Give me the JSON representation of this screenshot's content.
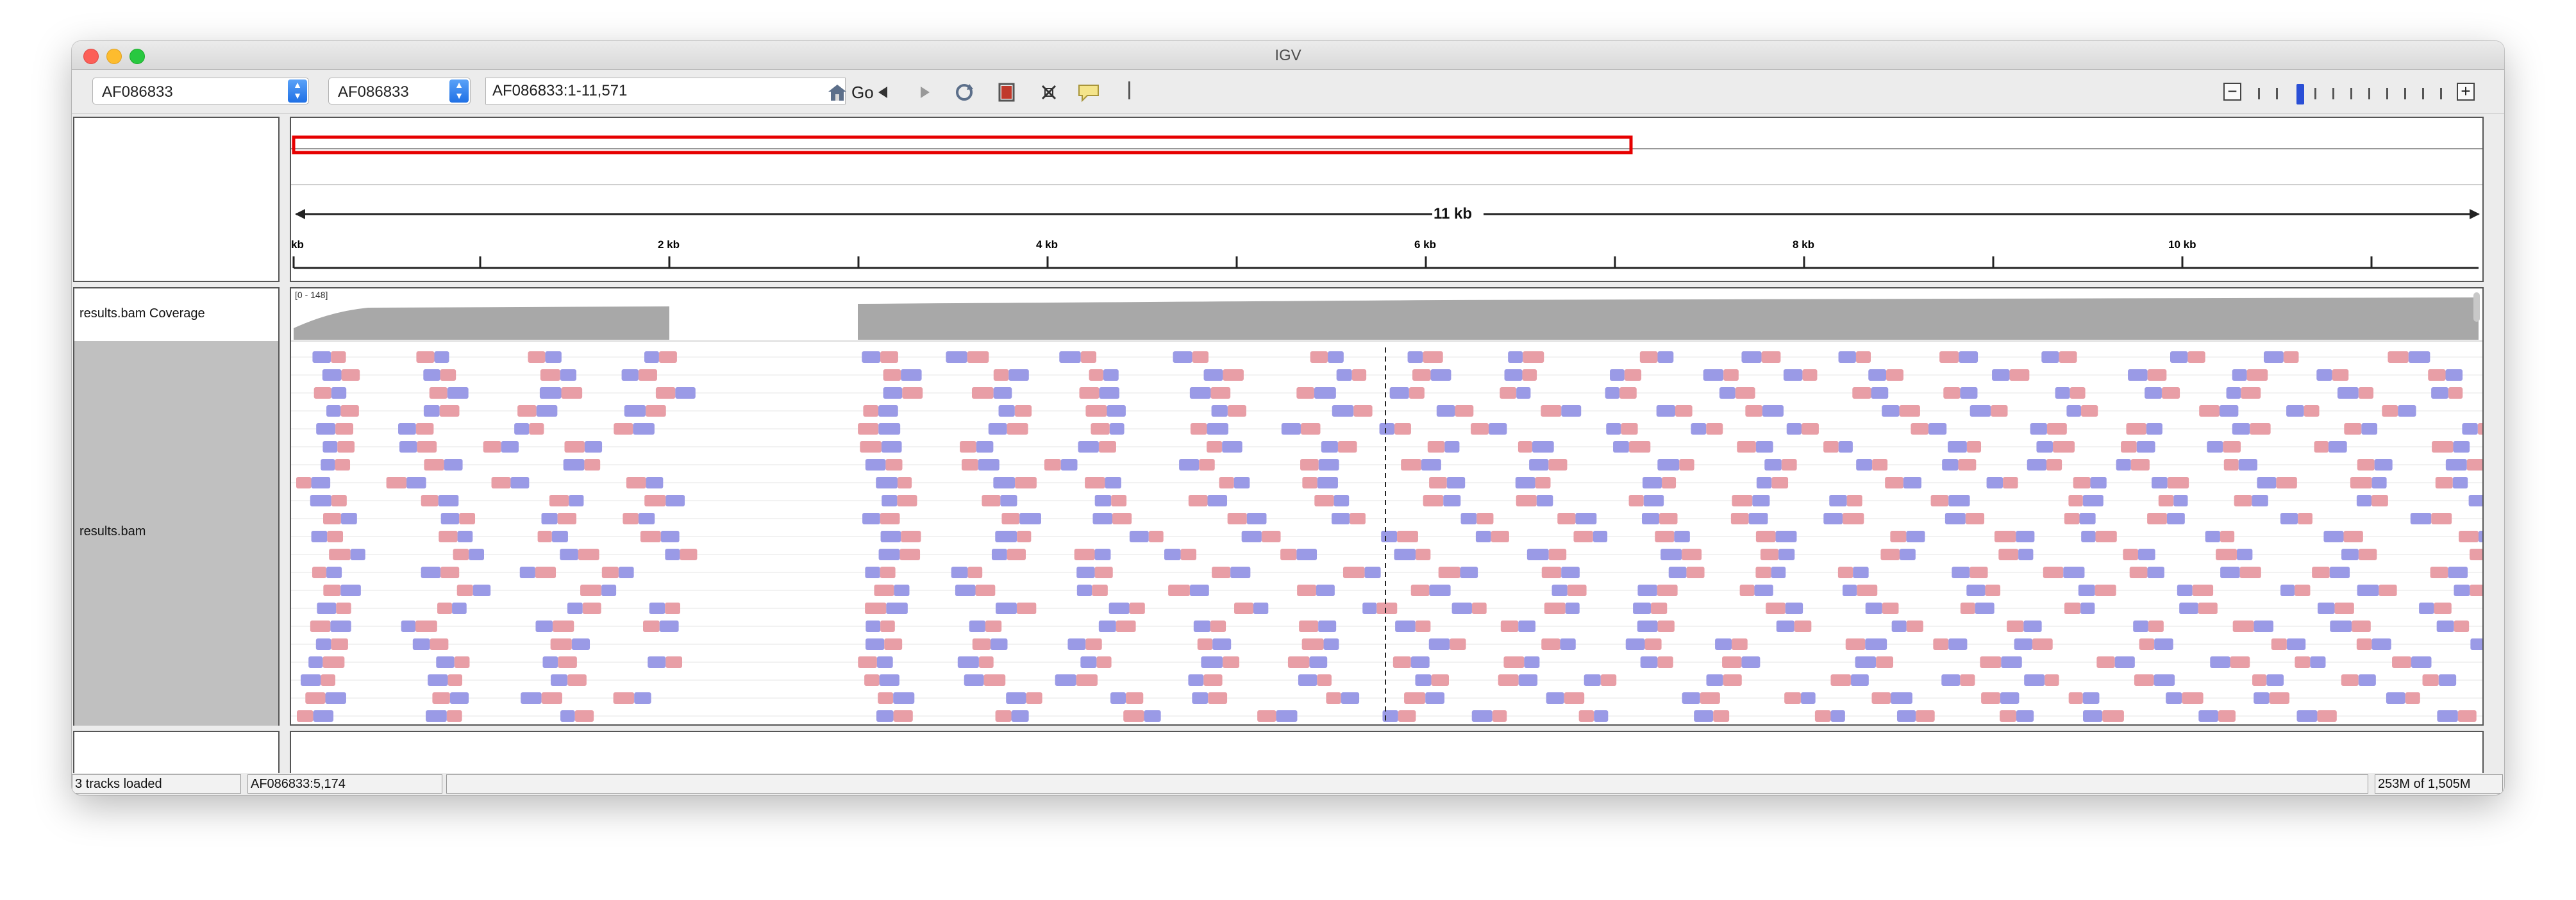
{
  "window": {
    "title": "IGV"
  },
  "toolbar": {
    "genome": "AF086833",
    "chromosome": "AF086833",
    "locus": "AF086833:1-11,571",
    "go_label": "Go"
  },
  "ruler": {
    "span_label": "11 kb",
    "ticks": [
      "kb",
      "2 kb",
      "4 kb",
      "6 kb",
      "8 kb",
      "10 kb"
    ]
  },
  "tracks": {
    "coverage_name": "results.bam Coverage",
    "coverage_range": "[0 - 148]",
    "alignment_name": "results.bam"
  },
  "status": {
    "tracks_loaded": "3 tracks loaded",
    "position": "AF086833:5,174",
    "memory": "253M of 1,505M"
  },
  "colors": {
    "forward_read": "#e89ea6",
    "reverse_read": "#9a9ae6",
    "coverage": "#a8a8a8",
    "roi_box": "#e60000"
  },
  "icons": [
    "home-icon",
    "back-icon",
    "forward-icon",
    "refresh-icon",
    "roi-icon",
    "fit-icon",
    "popup-info-icon",
    "zoom-out-icon",
    "zoom-in-icon"
  ]
}
